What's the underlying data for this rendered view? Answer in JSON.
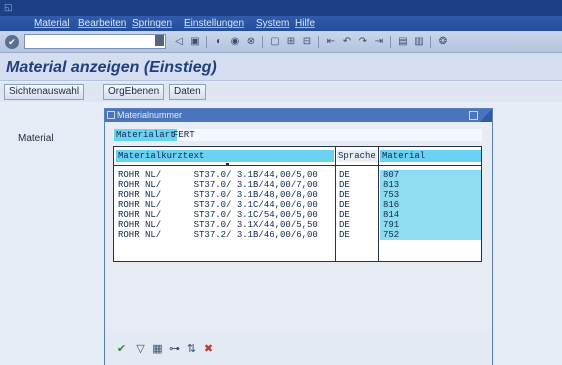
{
  "menu": [
    "Material",
    "Bearbeiten",
    "Springen",
    "Einstellungen",
    "System",
    "Hilfe"
  ],
  "command_field": {
    "value": ""
  },
  "page_title": "Material anzeigen (Einstieg)",
  "app_toolbar": {
    "buttons": [
      "Sichtenauswahl",
      "OrgEbenen",
      "Daten"
    ]
  },
  "main": {
    "field_label": "Material"
  },
  "dialog": {
    "title": "Materialnummer",
    "filter": {
      "label": "Materialart",
      "value": "FERT"
    },
    "columns": [
      "Materialkurztext",
      "Sprache",
      "Material"
    ],
    "rows": [
      {
        "text": "ROHR NL/      ST37.0/ 3.1B/44,00/5,00",
        "lang": "DE",
        "material": "807"
      },
      {
        "text": "ROHR NL/      ST37.0/ 3.1B/44,00/7,00",
        "lang": "DE",
        "material": "813"
      },
      {
        "text": "ROHR NL/      ST37.0/ 3.1B/48,00/8,00",
        "lang": "DE",
        "material": "753"
      },
      {
        "text": "ROHR NL/      ST37.0/ 3.1C/44,00/6,00",
        "lang": "DE",
        "material": "816"
      },
      {
        "text": "ROHR NL/      ST37.0/ 3.1C/54,00/5,00",
        "lang": "DE",
        "material": "814"
      },
      {
        "text": "ROHR NL/      ST37.0/ 3.1X/44,00/5,50",
        "lang": "DE",
        "material": "791"
      },
      {
        "text": "ROHR NL/      ST37.2/ 3.1B/46,00/6,00",
        "lang": "DE",
        "material": "752"
      }
    ],
    "footer_icons": [
      "check-icon",
      "filter-icon",
      "table-icon",
      "binoculars-icon",
      "sort-icon",
      "cancel-icon"
    ]
  },
  "colors": {
    "header": "#1d3f86",
    "menubar": "#2e5cab",
    "highlight": "#6ad2f2",
    "title": "#203f7d"
  }
}
